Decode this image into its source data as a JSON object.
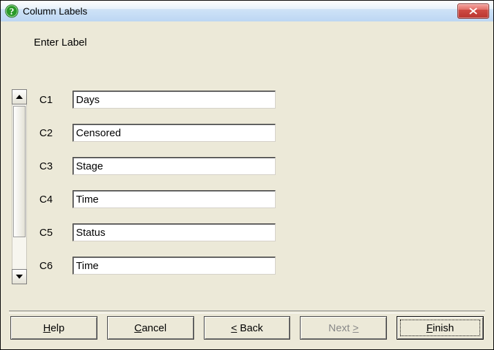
{
  "window": {
    "title": "Column Labels"
  },
  "prompt": "Enter Label",
  "columns": [
    {
      "id": "C1",
      "value": "Days"
    },
    {
      "id": "C2",
      "value": "Censored"
    },
    {
      "id": "C3",
      "value": "Stage"
    },
    {
      "id": "C4",
      "value": "Time"
    },
    {
      "id": "C5",
      "value": "Status"
    },
    {
      "id": "C6",
      "value": "Time"
    }
  ],
  "buttons": {
    "help": {
      "pre": "",
      "u": "H",
      "post": "elp"
    },
    "cancel": {
      "pre": "",
      "u": "C",
      "post": "ancel"
    },
    "back": {
      "pre": "",
      "u": "<",
      "post": " Back"
    },
    "next": {
      "pre": "Next ",
      "u": ">",
      "post": ""
    },
    "finish": {
      "pre": "",
      "u": "F",
      "post": "inish"
    }
  }
}
